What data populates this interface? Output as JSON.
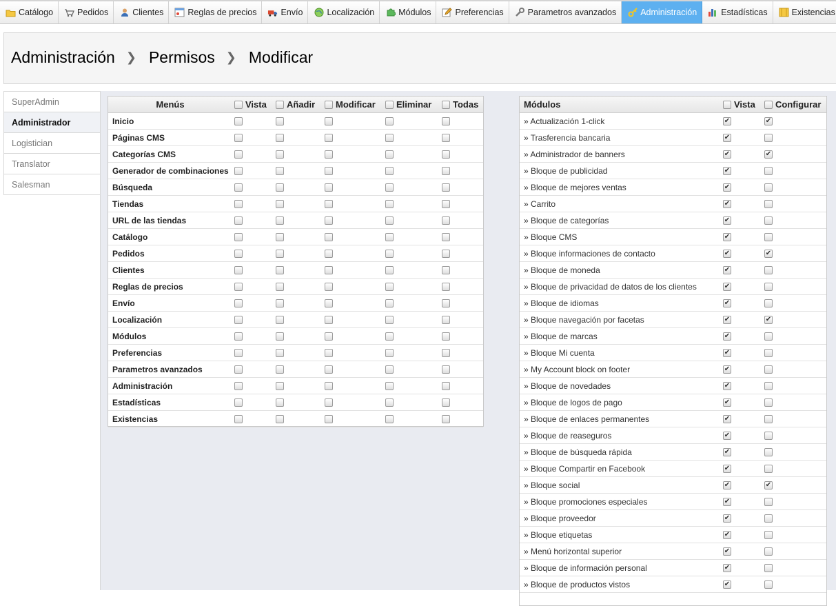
{
  "nav": [
    {
      "label": "Catálogo",
      "icon": "folder-icon",
      "active": false
    },
    {
      "label": "Pedidos",
      "icon": "cart-icon",
      "active": false
    },
    {
      "label": "Clientes",
      "icon": "user-icon",
      "active": false
    },
    {
      "label": "Reglas de precios",
      "icon": "price-rules-icon",
      "active": false
    },
    {
      "label": "Envío",
      "icon": "truck-icon",
      "active": false
    },
    {
      "label": "Localización",
      "icon": "globe-icon",
      "active": false
    },
    {
      "label": "Módulos",
      "icon": "puzzle-icon",
      "active": false
    },
    {
      "label": "Preferencias",
      "icon": "pencil-icon",
      "active": false
    },
    {
      "label": "Parametros avanzados",
      "icon": "wrench-icon",
      "active": false
    },
    {
      "label": "Administración",
      "icon": "key-icon",
      "active": true
    },
    {
      "label": "Estadísticas",
      "icon": "bar-chart-icon",
      "active": false
    },
    {
      "label": "Existencias",
      "icon": "box-icon",
      "active": false
    }
  ],
  "breadcrumb": [
    "Administración",
    "Permisos",
    "Modificar"
  ],
  "profiles": [
    {
      "label": "SuperAdmin",
      "active": false
    },
    {
      "label": "Administrador",
      "active": true
    },
    {
      "label": "Logistician",
      "active": false
    },
    {
      "label": "Translator",
      "active": false
    },
    {
      "label": "Salesman",
      "active": false
    }
  ],
  "menus_table": {
    "header": {
      "name": "Menús",
      "columns": [
        "Vista",
        "Añadir",
        "Modificar",
        "Eliminar",
        "Todas"
      ]
    },
    "rows": [
      {
        "name": "Inicio",
        "checks": [
          false,
          false,
          false,
          false,
          false
        ]
      },
      {
        "name": "Páginas CMS",
        "checks": [
          false,
          false,
          false,
          false,
          false
        ]
      },
      {
        "name": "Categorías CMS",
        "checks": [
          false,
          false,
          false,
          false,
          false
        ]
      },
      {
        "name": "Generador de combinaciones",
        "checks": [
          false,
          false,
          false,
          false,
          false
        ]
      },
      {
        "name": "Búsqueda",
        "checks": [
          false,
          false,
          false,
          false,
          false
        ]
      },
      {
        "name": "Tiendas",
        "checks": [
          false,
          false,
          false,
          false,
          false
        ]
      },
      {
        "name": "URL de las tiendas",
        "checks": [
          false,
          false,
          false,
          false,
          false
        ]
      },
      {
        "name": "Catálogo",
        "checks": [
          false,
          false,
          false,
          false,
          false
        ]
      },
      {
        "name": "Pedidos",
        "checks": [
          false,
          false,
          false,
          false,
          false
        ]
      },
      {
        "name": "Clientes",
        "checks": [
          false,
          false,
          false,
          false,
          false
        ]
      },
      {
        "name": "Reglas de precios",
        "checks": [
          false,
          false,
          false,
          false,
          false
        ]
      },
      {
        "name": "Envío",
        "checks": [
          false,
          false,
          false,
          false,
          false
        ]
      },
      {
        "name": "Localización",
        "checks": [
          false,
          false,
          false,
          false,
          false
        ]
      },
      {
        "name": "Módulos",
        "checks": [
          false,
          false,
          false,
          false,
          false
        ]
      },
      {
        "name": "Preferencias",
        "checks": [
          false,
          false,
          false,
          false,
          false
        ]
      },
      {
        "name": "Parametros avanzados",
        "checks": [
          false,
          false,
          false,
          false,
          false
        ]
      },
      {
        "name": "Administración",
        "checks": [
          false,
          false,
          false,
          false,
          false
        ]
      },
      {
        "name": "Estadísticas",
        "checks": [
          false,
          false,
          false,
          false,
          false
        ]
      },
      {
        "name": "Existencias",
        "checks": [
          false,
          false,
          false,
          false,
          false
        ]
      }
    ]
  },
  "modules_table": {
    "header": {
      "name": "Módulos",
      "columns": [
        "Vista",
        "Configurar"
      ]
    },
    "rows": [
      {
        "name": "» Actualización 1-click",
        "checks": [
          true,
          true
        ]
      },
      {
        "name": "» Trasferencia bancaria",
        "checks": [
          true,
          false
        ]
      },
      {
        "name": "» Administrador de banners",
        "checks": [
          true,
          true
        ]
      },
      {
        "name": "» Bloque de publicidad",
        "checks": [
          true,
          false
        ]
      },
      {
        "name": "» Bloque de mejores ventas",
        "checks": [
          true,
          false
        ]
      },
      {
        "name": "» Carrito",
        "checks": [
          true,
          false
        ]
      },
      {
        "name": "» Bloque de categorías",
        "checks": [
          true,
          false
        ]
      },
      {
        "name": "» Bloque CMS",
        "checks": [
          true,
          false
        ]
      },
      {
        "name": "» Bloque informaciones de contacto",
        "checks": [
          true,
          true
        ]
      },
      {
        "name": "» Bloque de moneda",
        "checks": [
          true,
          false
        ]
      },
      {
        "name": "» Bloque de privacidad de datos de los clientes",
        "checks": [
          true,
          false
        ]
      },
      {
        "name": "» Bloque de idiomas",
        "checks": [
          true,
          false
        ]
      },
      {
        "name": "» Bloque navegación por facetas",
        "checks": [
          true,
          true
        ]
      },
      {
        "name": "» Bloque de marcas",
        "checks": [
          true,
          false
        ]
      },
      {
        "name": "» Bloque Mi cuenta",
        "checks": [
          true,
          false
        ]
      },
      {
        "name": "» My Account block on footer",
        "checks": [
          true,
          false
        ]
      },
      {
        "name": "» Bloque de novedades",
        "checks": [
          true,
          false
        ]
      },
      {
        "name": "» Bloque de logos de pago",
        "checks": [
          true,
          false
        ]
      },
      {
        "name": "» Bloque de enlaces permanentes",
        "checks": [
          true,
          false
        ]
      },
      {
        "name": "» Bloque de reaseguros",
        "checks": [
          true,
          false
        ]
      },
      {
        "name": "» Bloque de búsqueda rápida",
        "checks": [
          true,
          false
        ]
      },
      {
        "name": "» Bloque Compartir en Facebook",
        "checks": [
          true,
          false
        ]
      },
      {
        "name": "» Bloque social",
        "checks": [
          true,
          true
        ]
      },
      {
        "name": "» Bloque promociones especiales",
        "checks": [
          true,
          false
        ]
      },
      {
        "name": "» Bloque proveedor",
        "checks": [
          true,
          false
        ]
      },
      {
        "name": "» Bloque etiquetas",
        "checks": [
          true,
          false
        ]
      },
      {
        "name": "» Menú horizontal superior",
        "checks": [
          true,
          false
        ]
      },
      {
        "name": "» Bloque de información personal",
        "checks": [
          true,
          false
        ]
      },
      {
        "name": "» Bloque de productos vistos",
        "checks": [
          true,
          false
        ]
      }
    ]
  }
}
